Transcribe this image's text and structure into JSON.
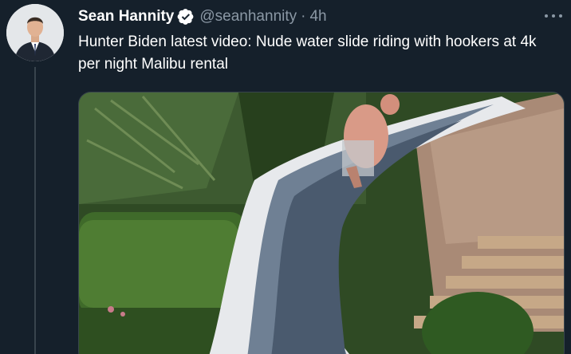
{
  "tweet": {
    "display_name": "Sean Hannity",
    "handle": "@seanhannity",
    "separator": "·",
    "timestamp": "4h",
    "text": "Hunter Biden latest video: Nude water slide riding with hookers at 4k per night Malibu rental"
  },
  "icons": {
    "verified": "verified-badge-icon",
    "more": "more-options-icon"
  },
  "colors": {
    "background": "#15202b",
    "primary_text": "#ffffff",
    "secondary_text": "#8b98a5",
    "border": "#38444d"
  }
}
